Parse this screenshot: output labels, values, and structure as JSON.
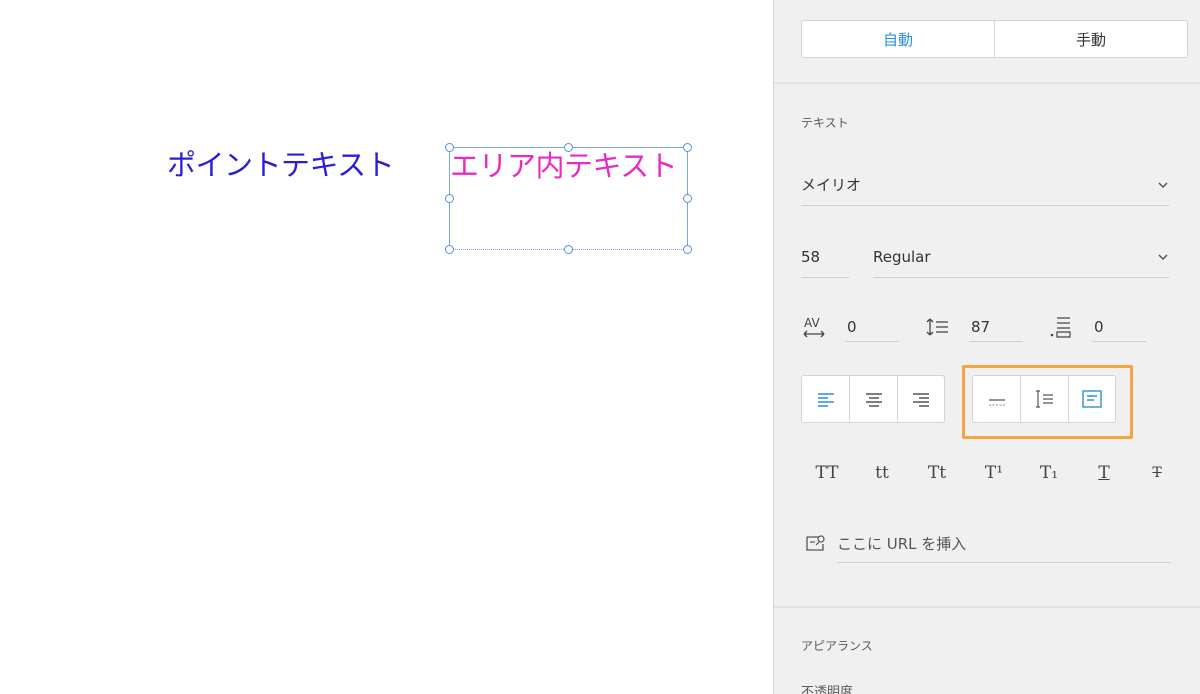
{
  "canvas": {
    "point_text": "ポイントテキスト",
    "area_text": "エリア内テキスト",
    "colors": {
      "point_text": "#2b1fd6",
      "area_text": "#e62cc3",
      "selection": "#7aa6e8"
    }
  },
  "panel": {
    "sizing_tabs": [
      {
        "label": "自動",
        "active": true
      },
      {
        "label": "手動",
        "active": false
      }
    ],
    "text_section": {
      "title": "テキスト",
      "font_family": "メイリオ",
      "font_size": "58",
      "font_weight": "Regular",
      "character_spacing": "0",
      "line_spacing": "87",
      "paragraph_spacing": "0",
      "align_buttons": [
        "align-left",
        "align-center",
        "align-right"
      ],
      "text_type_buttons": [
        "point-text",
        "auto-height",
        "fixed-size"
      ],
      "style_buttons": [
        "TT",
        "tt",
        "Tt",
        "T¹",
        "T₁",
        "T",
        "T"
      ],
      "url_placeholder": "ここに URL を挿入"
    },
    "appearance_section": {
      "title": "アピアランス",
      "opacity_label": "不透明度"
    },
    "accent_color": "#2b8fd6",
    "highlight_color": "#f2a541"
  }
}
